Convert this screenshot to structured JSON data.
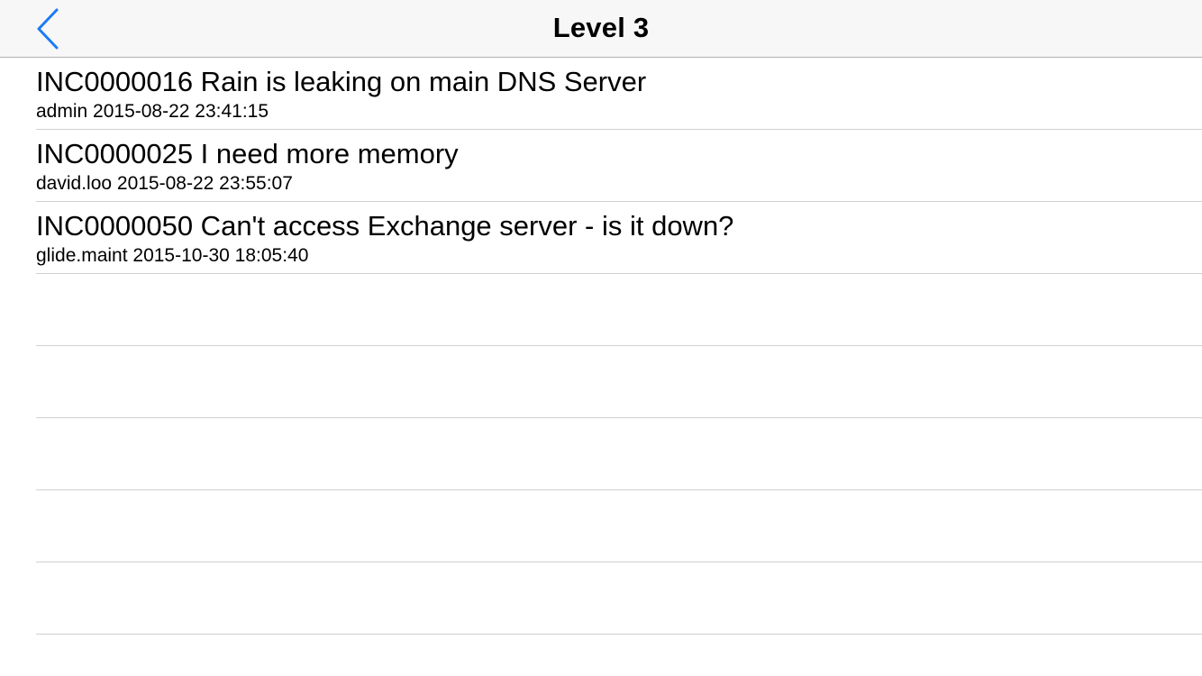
{
  "nav": {
    "back_icon": "chevron-left-icon",
    "title": "Level 3",
    "accent_color": "#1a7cf5"
  },
  "incidents": [
    {
      "title": "INC0000016 Rain is leaking on main DNS Server",
      "subtitle": "admin 2015-08-22 23:41:15"
    },
    {
      "title": "INC0000025 I need more memory",
      "subtitle": "david.loo 2015-08-22 23:55:07"
    },
    {
      "title": "INC0000050 Can't access Exchange server - is it down?",
      "subtitle": "glide.maint 2015-10-30 18:05:40"
    }
  ]
}
